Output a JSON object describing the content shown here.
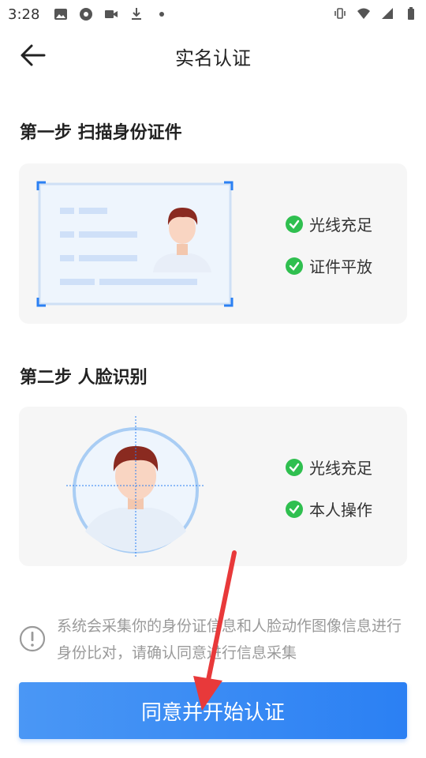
{
  "status_bar": {
    "time": "3:28",
    "left_icons": [
      "image-icon",
      "record-icon",
      "video-icon",
      "download-icon",
      "dot-icon"
    ],
    "right_icons": [
      "vibrate-icon",
      "wifi-icon",
      "signal-icon",
      "battery-icon"
    ]
  },
  "header": {
    "title": "实名认证",
    "back_icon": "arrow-left-icon"
  },
  "step1": {
    "title": "第一步 扫描身份证件",
    "checks": [
      "光线充足",
      "证件平放"
    ]
  },
  "step2": {
    "title": "第二步 人脸识别",
    "checks": [
      "光线充足",
      "本人操作"
    ]
  },
  "notice": {
    "icon": "info-icon",
    "text": "系统会采集你的身份证信息和人脸动作图像信息进行身份比对，请确认同意进行信息采集"
  },
  "primary_button": {
    "label": "同意并开始认证"
  },
  "colors": {
    "accent": "#2b80f3",
    "check_green": "#2fbf4f",
    "card_bg": "#f6f6f6",
    "annotation_red": "#e8393a"
  }
}
